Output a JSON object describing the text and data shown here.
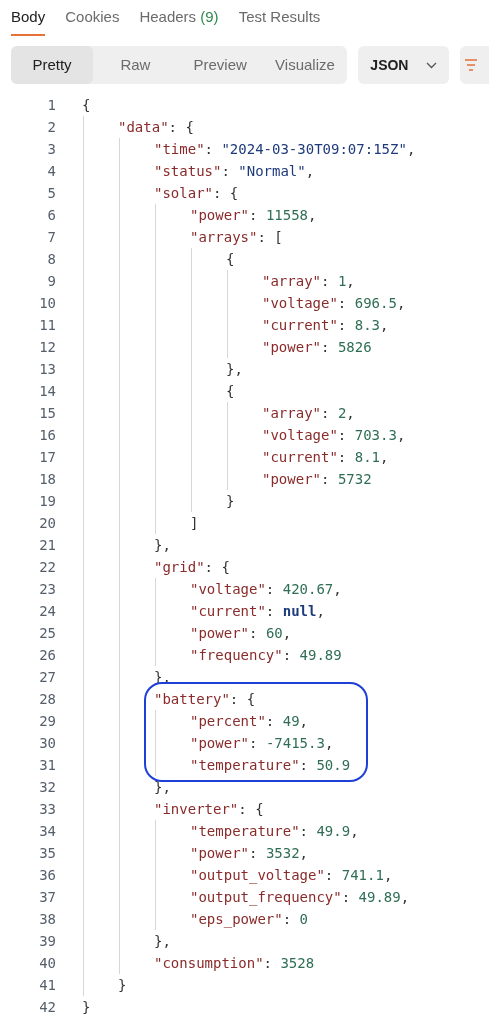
{
  "tabs": [
    {
      "label": "Body",
      "selected": true
    },
    {
      "label": "Cookies",
      "selected": false
    },
    {
      "label": "Headers",
      "count": "(9)",
      "selected": false
    },
    {
      "label": "Test Results",
      "selected": false
    }
  ],
  "view_modes": [
    {
      "label": "Pretty",
      "selected": true
    },
    {
      "label": "Raw",
      "selected": false
    },
    {
      "label": "Preview",
      "selected": false
    },
    {
      "label": "Visualize",
      "selected": false
    }
  ],
  "format": {
    "label": "JSON"
  },
  "code": {
    "lines": [
      {
        "kind": "line",
        "number": "1",
        "tokens": [
          {
            "kind": "punct",
            "text": "{"
          }
        ],
        "children": [
          {
            "kind": "line",
            "number": "2",
            "tokens": [
              {
                "kind": "key",
                "text": "\"data\""
              },
              {
                "kind": "punct",
                "text": ": {"
              }
            ],
            "children": [
              {
                "kind": "line",
                "number": "3",
                "tokens": [
                  {
                    "kind": "key",
                    "text": "\"time\""
                  },
                  {
                    "kind": "punct",
                    "text": ": "
                  },
                  {
                    "kind": "string",
                    "text": "\"2024-03-30T09:07:15Z\""
                  },
                  {
                    "kind": "punct",
                    "text": ","
                  }
                ]
              },
              {
                "kind": "line",
                "number": "4",
                "tokens": [
                  {
                    "kind": "key",
                    "text": "\"status\""
                  },
                  {
                    "kind": "punct",
                    "text": ": "
                  },
                  {
                    "kind": "string",
                    "text": "\"Normal\""
                  },
                  {
                    "kind": "punct",
                    "text": ","
                  }
                ]
              },
              {
                "kind": "line",
                "number": "5",
                "tokens": [
                  {
                    "kind": "key",
                    "text": "\"solar\""
                  },
                  {
                    "kind": "punct",
                    "text": ": {"
                  }
                ],
                "children": [
                  {
                    "kind": "line",
                    "number": "6",
                    "tokens": [
                      {
                        "kind": "key",
                        "text": "\"power\""
                      },
                      {
                        "kind": "punct",
                        "text": ": "
                      },
                      {
                        "kind": "number",
                        "text": "11558"
                      },
                      {
                        "kind": "punct",
                        "text": ","
                      }
                    ]
                  },
                  {
                    "kind": "line",
                    "number": "7",
                    "tokens": [
                      {
                        "kind": "key",
                        "text": "\"arrays\""
                      },
                      {
                        "kind": "punct",
                        "text": ": ["
                      }
                    ],
                    "children": [
                      {
                        "kind": "line",
                        "number": "8",
                        "tokens": [
                          {
                            "kind": "punct",
                            "text": "{"
                          }
                        ],
                        "children": [
                          {
                            "kind": "line",
                            "number": "9",
                            "tokens": [
                              {
                                "kind": "key",
                                "text": "\"array\""
                              },
                              {
                                "kind": "punct",
                                "text": ": "
                              },
                              {
                                "kind": "number",
                                "text": "1"
                              },
                              {
                                "kind": "punct",
                                "text": ","
                              }
                            ]
                          },
                          {
                            "kind": "line",
                            "number": "10",
                            "tokens": [
                              {
                                "kind": "key",
                                "text": "\"voltage\""
                              },
                              {
                                "kind": "punct",
                                "text": ": "
                              },
                              {
                                "kind": "number",
                                "text": "696.5"
                              },
                              {
                                "kind": "punct",
                                "text": ","
                              }
                            ]
                          },
                          {
                            "kind": "line",
                            "number": "11",
                            "tokens": [
                              {
                                "kind": "key",
                                "text": "\"current\""
                              },
                              {
                                "kind": "punct",
                                "text": ": "
                              },
                              {
                                "kind": "number",
                                "text": "8.3"
                              },
                              {
                                "kind": "punct",
                                "text": ","
                              }
                            ]
                          },
                          {
                            "kind": "line",
                            "number": "12",
                            "tokens": [
                              {
                                "kind": "key",
                                "text": "\"power\""
                              },
                              {
                                "kind": "punct",
                                "text": ": "
                              },
                              {
                                "kind": "number",
                                "text": "5826"
                              }
                            ]
                          }
                        ]
                      },
                      {
                        "kind": "line",
                        "number": "13",
                        "tokens": [
                          {
                            "kind": "punct",
                            "text": "},"
                          }
                        ]
                      },
                      {
                        "kind": "line",
                        "number": "14",
                        "tokens": [
                          {
                            "kind": "punct",
                            "text": "{"
                          }
                        ],
                        "children": [
                          {
                            "kind": "line",
                            "number": "15",
                            "tokens": [
                              {
                                "kind": "key",
                                "text": "\"array\""
                              },
                              {
                                "kind": "punct",
                                "text": ": "
                              },
                              {
                                "kind": "number",
                                "text": "2"
                              },
                              {
                                "kind": "punct",
                                "text": ","
                              }
                            ]
                          },
                          {
                            "kind": "line",
                            "number": "16",
                            "tokens": [
                              {
                                "kind": "key",
                                "text": "\"voltage\""
                              },
                              {
                                "kind": "punct",
                                "text": ": "
                              },
                              {
                                "kind": "number",
                                "text": "703.3"
                              },
                              {
                                "kind": "punct",
                                "text": ","
                              }
                            ]
                          },
                          {
                            "kind": "line",
                            "number": "17",
                            "tokens": [
                              {
                                "kind": "key",
                                "text": "\"current\""
                              },
                              {
                                "kind": "punct",
                                "text": ": "
                              },
                              {
                                "kind": "number",
                                "text": "8.1"
                              },
                              {
                                "kind": "punct",
                                "text": ","
                              }
                            ]
                          },
                          {
                            "kind": "line",
                            "number": "18",
                            "tokens": [
                              {
                                "kind": "key",
                                "text": "\"power\""
                              },
                              {
                                "kind": "punct",
                                "text": ": "
                              },
                              {
                                "kind": "number",
                                "text": "5732"
                              }
                            ]
                          }
                        ]
                      },
                      {
                        "kind": "line",
                        "number": "19",
                        "tokens": [
                          {
                            "kind": "punct",
                            "text": "}"
                          }
                        ]
                      }
                    ]
                  },
                  {
                    "kind": "line",
                    "number": "20",
                    "tokens": [
                      {
                        "kind": "punct",
                        "text": "]"
                      }
                    ]
                  }
                ]
              },
              {
                "kind": "line",
                "number": "21",
                "tokens": [
                  {
                    "kind": "punct",
                    "text": "},"
                  }
                ]
              },
              {
                "kind": "line",
                "number": "22",
                "tokens": [
                  {
                    "kind": "key",
                    "text": "\"grid\""
                  },
                  {
                    "kind": "punct",
                    "text": ": {"
                  }
                ],
                "children": [
                  {
                    "kind": "line",
                    "number": "23",
                    "tokens": [
                      {
                        "kind": "key",
                        "text": "\"voltage\""
                      },
                      {
                        "kind": "punct",
                        "text": ": "
                      },
                      {
                        "kind": "number",
                        "text": "420.67"
                      },
                      {
                        "kind": "punct",
                        "text": ","
                      }
                    ]
                  },
                  {
                    "kind": "line",
                    "number": "24",
                    "tokens": [
                      {
                        "kind": "key",
                        "text": "\"current\""
                      },
                      {
                        "kind": "punct",
                        "text": ": "
                      },
                      {
                        "kind": "keyword",
                        "text": "null"
                      },
                      {
                        "kind": "punct",
                        "text": ","
                      }
                    ]
                  },
                  {
                    "kind": "line",
                    "number": "25",
                    "tokens": [
                      {
                        "kind": "key",
                        "text": "\"power\""
                      },
                      {
                        "kind": "punct",
                        "text": ": "
                      },
                      {
                        "kind": "number",
                        "text": "60"
                      },
                      {
                        "kind": "punct",
                        "text": ","
                      }
                    ]
                  },
                  {
                    "kind": "line",
                    "number": "26",
                    "tokens": [
                      {
                        "kind": "key",
                        "text": "\"frequency\""
                      },
                      {
                        "kind": "punct",
                        "text": ": "
                      },
                      {
                        "kind": "number",
                        "text": "49.89"
                      }
                    ]
                  }
                ]
              },
              {
                "kind": "line",
                "number": "27",
                "tokens": [
                  {
                    "kind": "punct",
                    "text": "},"
                  }
                ]
              },
              {
                "kind": "outline",
                "lines": [
                  {
                    "kind": "line",
                    "number": "28",
                    "tokens": [
                      {
                        "kind": "key",
                        "text": "\"battery\""
                      },
                      {
                        "kind": "punct",
                        "text": ": {"
                      }
                    ],
                    "children": [
                      {
                        "kind": "line",
                        "number": "29",
                        "tokens": [
                          {
                            "kind": "key",
                            "text": "\"percent\""
                          },
                          {
                            "kind": "punct",
                            "text": ": "
                          },
                          {
                            "kind": "number",
                            "text": "49"
                          },
                          {
                            "kind": "punct",
                            "text": ","
                          }
                        ]
                      },
                      {
                        "kind": "line",
                        "number": "30",
                        "tokens": [
                          {
                            "kind": "key",
                            "text": "\"power\""
                          },
                          {
                            "kind": "punct",
                            "text": ": "
                          },
                          {
                            "kind": "number",
                            "text": "-7415.3"
                          },
                          {
                            "kind": "punct",
                            "text": ","
                          }
                        ]
                      },
                      {
                        "kind": "line",
                        "number": "31",
                        "tokens": [
                          {
                            "kind": "key",
                            "text": "\"temperature\""
                          },
                          {
                            "kind": "punct",
                            "text": ": "
                          },
                          {
                            "kind": "number",
                            "text": "50.9"
                          }
                        ]
                      }
                    ]
                  }
                ]
              },
              {
                "kind": "line",
                "number": "32",
                "tokens": [
                  {
                    "kind": "punct",
                    "text": "},"
                  }
                ]
              },
              {
                "kind": "line",
                "number": "33",
                "tokens": [
                  {
                    "kind": "key",
                    "text": "\"inverter\""
                  },
                  {
                    "kind": "punct",
                    "text": ": {"
                  }
                ],
                "children": [
                  {
                    "kind": "line",
                    "number": "34",
                    "tokens": [
                      {
                        "kind": "key",
                        "text": "\"temperature\""
                      },
                      {
                        "kind": "punct",
                        "text": ": "
                      },
                      {
                        "kind": "number",
                        "text": "49.9"
                      },
                      {
                        "kind": "punct",
                        "text": ","
                      }
                    ]
                  },
                  {
                    "kind": "line",
                    "number": "35",
                    "tokens": [
                      {
                        "kind": "key",
                        "text": "\"power\""
                      },
                      {
                        "kind": "punct",
                        "text": ": "
                      },
                      {
                        "kind": "number",
                        "text": "3532"
                      },
                      {
                        "kind": "punct",
                        "text": ","
                      }
                    ]
                  },
                  {
                    "kind": "line",
                    "number": "36",
                    "tokens": [
                      {
                        "kind": "key",
                        "text": "\"output_voltage\""
                      },
                      {
                        "kind": "punct",
                        "text": ": "
                      },
                      {
                        "kind": "number",
                        "text": "741.1"
                      },
                      {
                        "kind": "punct",
                        "text": ","
                      }
                    ]
                  },
                  {
                    "kind": "line",
                    "number": "37",
                    "tokens": [
                      {
                        "kind": "key",
                        "text": "\"output_frequency\""
                      },
                      {
                        "kind": "punct",
                        "text": ": "
                      },
                      {
                        "kind": "number",
                        "text": "49.89"
                      },
                      {
                        "kind": "punct",
                        "text": ","
                      }
                    ]
                  },
                  {
                    "kind": "line",
                    "number": "38",
                    "tokens": [
                      {
                        "kind": "key",
                        "text": "\"eps_power\""
                      },
                      {
                        "kind": "punct",
                        "text": ": "
                      },
                      {
                        "kind": "number",
                        "text": "0"
                      }
                    ]
                  }
                ]
              },
              {
                "kind": "line",
                "number": "39",
                "tokens": [
                  {
                    "kind": "punct",
                    "text": "},"
                  }
                ]
              },
              {
                "kind": "line",
                "number": "40",
                "tokens": [
                  {
                    "kind": "key",
                    "text": "\"consumption\""
                  },
                  {
                    "kind": "punct",
                    "text": ": "
                  },
                  {
                    "kind": "number",
                    "text": "3528"
                  }
                ]
              }
            ]
          },
          {
            "kind": "line",
            "number": "41",
            "tokens": [
              {
                "kind": "punct",
                "text": "}"
              }
            ]
          }
        ]
      },
      {
        "kind": "line",
        "number": "42",
        "tokens": [
          {
            "kind": "punct",
            "text": "}"
          }
        ]
      }
    ]
  }
}
